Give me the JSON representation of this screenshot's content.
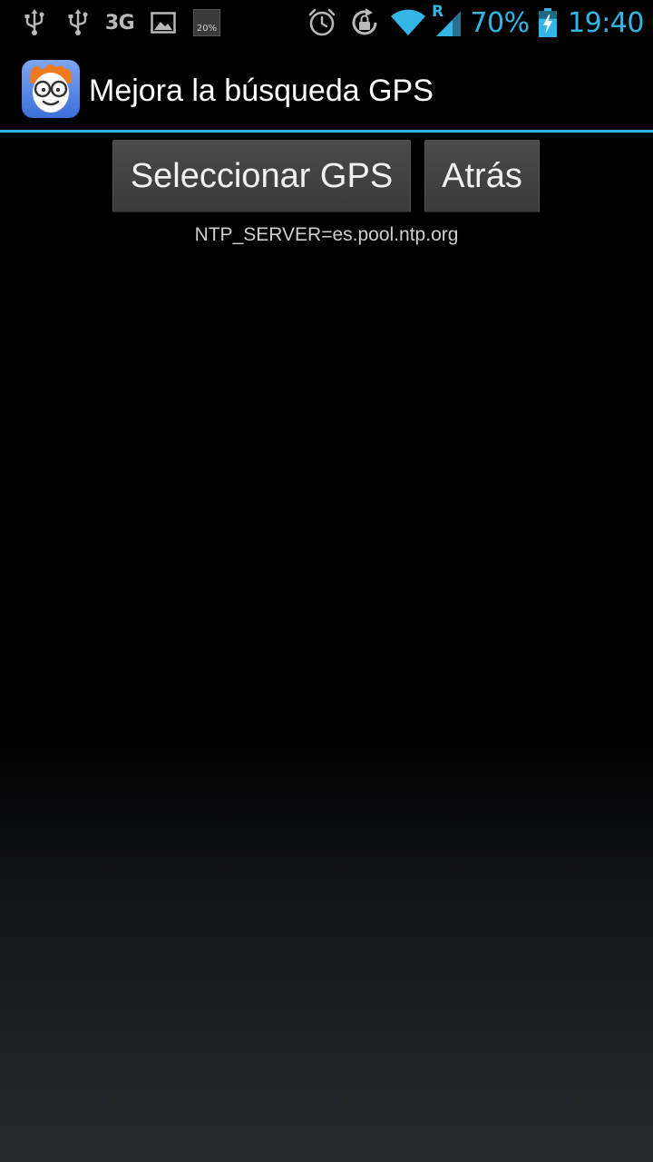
{
  "status_bar": {
    "left_icons": [
      "usb-icon",
      "usb-icon",
      "network-3g-text",
      "image-icon",
      "notification-thumb-icon"
    ],
    "network_type": "3G",
    "thumb_text": "20%",
    "right_icons": [
      "alarm-icon",
      "rotation-lock-icon",
      "wifi-icon",
      "signal-roaming-icon",
      "battery-charging-icon"
    ],
    "roaming_label": "R",
    "battery_percent": "70%",
    "battery_level": 0.7,
    "time": "19:40",
    "accent_color": "#33b5e5"
  },
  "action_bar": {
    "icon": "app-nerd-face-icon",
    "title": "Mejora la búsqueda GPS",
    "divider_color": "#33b5e5"
  },
  "main": {
    "select_button_label": "Seleccionar GPS",
    "back_button_label": "Atrás",
    "ntp_server_text": "NTP_SERVER=es.pool.ntp.org"
  }
}
